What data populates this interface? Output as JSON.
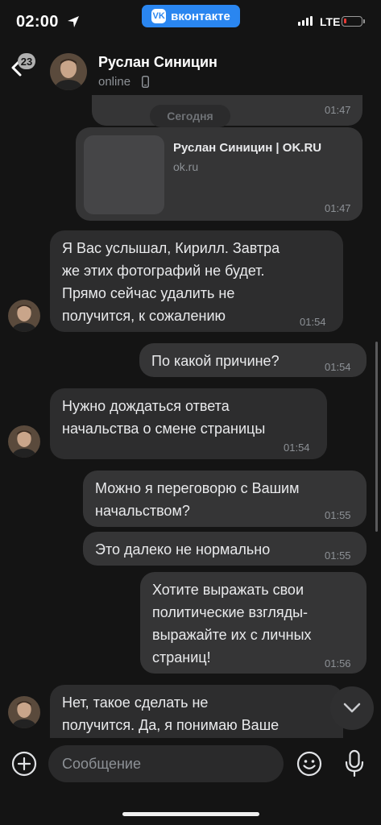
{
  "status_bar": {
    "time": "02:00",
    "app_pill": "вконтакте",
    "app_logo": "VK",
    "network": "LTE",
    "battery_level": 0.15
  },
  "header": {
    "unread_count": "23",
    "name": "Руслан Синицин",
    "status": "online",
    "status_icon": "phone-icon"
  },
  "chat": {
    "first_time": "01:47",
    "date_divider": "Сегодня",
    "link_card": {
      "title": "Руслан Синицин | OK.RU",
      "domain": "ok.ru",
      "time": "01:47"
    },
    "messages": [
      {
        "direction": "in",
        "text": "Я Вас услышал, Кирилл. Завтра\nже этих фотографий не будет.\nПрямо сейчас удалить не\nполучится, к сожалению",
        "time": "01:54"
      },
      {
        "direction": "out",
        "text": "По какой причине?",
        "time": "01:54"
      },
      {
        "direction": "in",
        "text": "Нужно дождаться ответа\nначальства о смене страницы",
        "time": "01:54"
      },
      {
        "direction": "out",
        "text": "Можно я переговорю с Вашим\nначальством?",
        "time": "01:55"
      },
      {
        "direction": "out",
        "text": "Это далеко не нормально",
        "time": "01:55"
      },
      {
        "direction": "out",
        "text": "Хотите выражать свои\nполитические взгляды-\nвыражайте их с личных\nстраниц!",
        "time": "01:56"
      },
      {
        "direction": "in",
        "text": "Нет, такое сделать не\nполучится. Да, я понимаю Ваше",
        "time": ""
      }
    ]
  },
  "composer": {
    "placeholder": "Сообщение"
  },
  "colors": {
    "background": "#141414",
    "bubble_in": "#2d2d2e",
    "bubble_out": "#353536",
    "accent": "#2a86f0",
    "battery_low": "#e53935"
  }
}
